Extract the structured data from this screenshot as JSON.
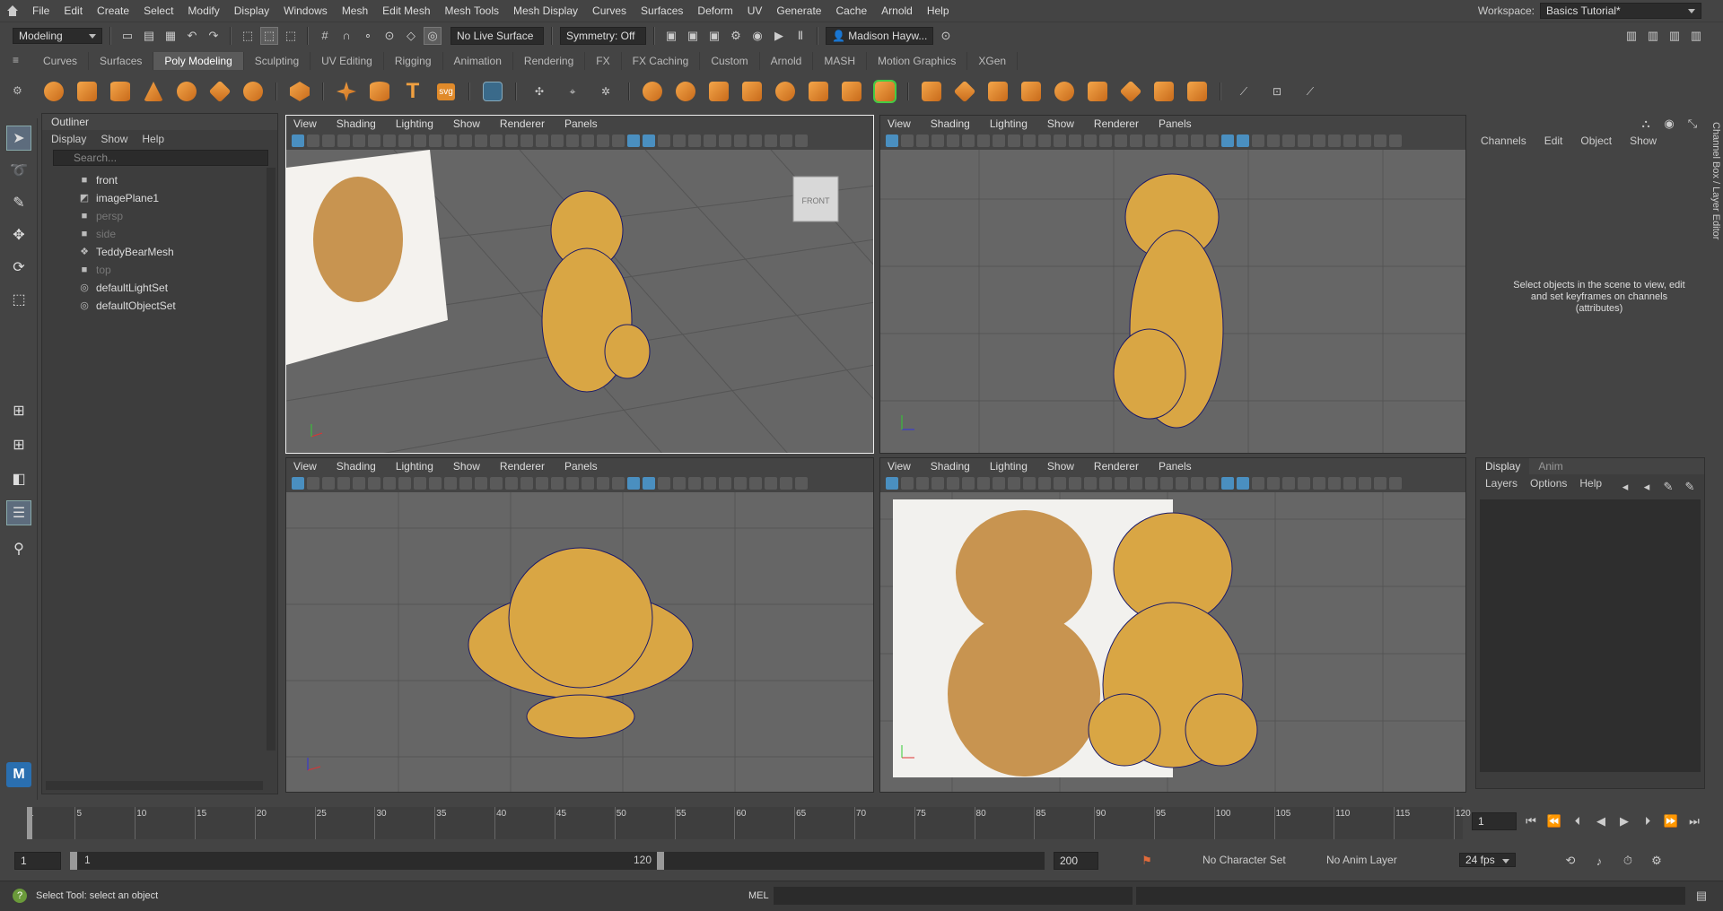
{
  "menubar": {
    "items": [
      "File",
      "Edit",
      "Create",
      "Select",
      "Modify",
      "Display",
      "Windows",
      "Mesh",
      "Edit Mesh",
      "Mesh Tools",
      "Mesh Display",
      "Curves",
      "Surfaces",
      "Deform",
      "UV",
      "Generate",
      "Cache",
      "Arnold",
      "Help"
    ],
    "workspace_label": "Workspace:",
    "workspace_value": "Basics Tutorial*"
  },
  "statusline": {
    "mode": "Modeling",
    "live_surface": "No Live Surface",
    "symmetry": "Symmetry: Off",
    "user": "Madison Hayw..."
  },
  "shelf": {
    "tabs": [
      "Curves",
      "Surfaces",
      "Poly Modeling",
      "Sculpting",
      "UV Editing",
      "Rigging",
      "Animation",
      "Rendering",
      "FX",
      "FX Caching",
      "Custom",
      "Arnold",
      "MASH",
      "Motion Graphics",
      "XGen"
    ],
    "active_tab": "Poly Modeling",
    "text_icon": "T",
    "svg_icon": "svg"
  },
  "outliner": {
    "title": "Outliner",
    "menu": [
      "Display",
      "Show",
      "Help"
    ],
    "search_placeholder": "Search...",
    "items": [
      {
        "label": "front",
        "icon": "camera-icon",
        "dim": false
      },
      {
        "label": "imagePlane1",
        "icon": "image-plane-icon",
        "dim": false
      },
      {
        "label": "persp",
        "icon": "camera-icon",
        "dim": true
      },
      {
        "label": "side",
        "icon": "camera-icon",
        "dim": true
      },
      {
        "label": "TeddyBearMesh",
        "icon": "mesh-icon",
        "dim": false
      },
      {
        "label": "top",
        "icon": "camera-icon",
        "dim": true
      },
      {
        "label": "defaultLightSet",
        "icon": "set-icon",
        "dim": false
      },
      {
        "label": "defaultObjectSet",
        "icon": "set-icon",
        "dim": false
      }
    ]
  },
  "viewport_menu": [
    "View",
    "Shading",
    "Lighting",
    "Show",
    "Renderer",
    "Panels"
  ],
  "viewcube": {
    "label": "FRONT"
  },
  "channelbox": {
    "menu": [
      "Channels",
      "Edit",
      "Object",
      "Show"
    ],
    "message": "Select objects in the scene to view, edit and set keyframes on channels (attributes)",
    "side_tab": "Channel Box / Layer Editor"
  },
  "layer_editor": {
    "tabs": [
      "Display",
      "Anim"
    ],
    "menu": [
      "Layers",
      "Options",
      "Help"
    ]
  },
  "timeslider": {
    "ticks": [
      "1",
      "5",
      "10",
      "15",
      "20",
      "25",
      "30",
      "35",
      "40",
      "45",
      "50",
      "55",
      "60",
      "65",
      "70",
      "75",
      "80",
      "85",
      "90",
      "95",
      "100",
      "105",
      "110",
      "115",
      "120"
    ],
    "current_frame": "1"
  },
  "rangebar": {
    "start": "1",
    "range_start": "1",
    "range_end": "120",
    "end": "200",
    "character_set": "No Character Set",
    "anim_layer": "No Anim Layer",
    "fps": "24 fps"
  },
  "helpline": {
    "message": "Select Tool: select an object",
    "mel_label": "MEL"
  },
  "colors": {
    "accent": "#4a8fc0",
    "mesh": "#d9a644",
    "wire": "#1a1a6a"
  }
}
